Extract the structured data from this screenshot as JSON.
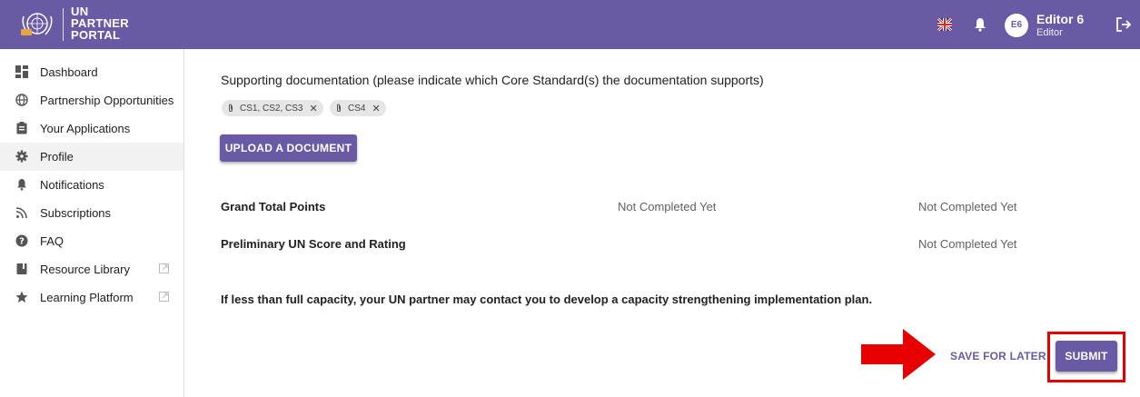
{
  "header": {
    "logo_lines": [
      "UN",
      "PARTNER",
      "PORTAL"
    ],
    "language_icon": "uk-flag-icon",
    "notifications_icon": "bell-icon",
    "avatar_initials": "E6",
    "user_name": "Editor 6",
    "user_role": "Editor",
    "logout_icon": "logout-icon",
    "accent_color": "#6a5aa5"
  },
  "sidebar": {
    "items": [
      {
        "label": "Dashboard",
        "icon": "dashboard-icon"
      },
      {
        "label": "Partnership Opportunities",
        "icon": "globe-icon"
      },
      {
        "label": "Your Applications",
        "icon": "clipboard-icon"
      },
      {
        "label": "Profile",
        "icon": "gear-icon",
        "active": true
      },
      {
        "label": "Notifications",
        "icon": "bell-icon"
      },
      {
        "label": "Subscriptions",
        "icon": "rss-icon"
      },
      {
        "label": "FAQ",
        "icon": "help-icon"
      },
      {
        "label": "Resource Library",
        "icon": "book-icon",
        "external": true
      },
      {
        "label": "Learning Platform",
        "icon": "star-icon",
        "external": true
      }
    ]
  },
  "main": {
    "supporting_doc_text": "Supporting documentation (please indicate which Core Standard(s) the documentation supports)",
    "chips": [
      {
        "label": "CS1, CS2, CS3"
      },
      {
        "label": "CS4"
      }
    ],
    "upload_button": "UPLOAD A DOCUMENT",
    "grand_total": {
      "label": "Grand Total Points",
      "value_1": "Not Completed Yet",
      "value_2": "Not Completed Yet"
    },
    "preliminary": {
      "label": "Preliminary UN Score and Rating",
      "value": "Not Completed Yet"
    },
    "capacity_note": "If less than full capacity, your UN partner may contact you to develop a capacity strengthening implementation plan.",
    "save_for_later": "SAVE FOR LATER",
    "submit": "SUBMIT",
    "highlight_color": "#e60000"
  }
}
